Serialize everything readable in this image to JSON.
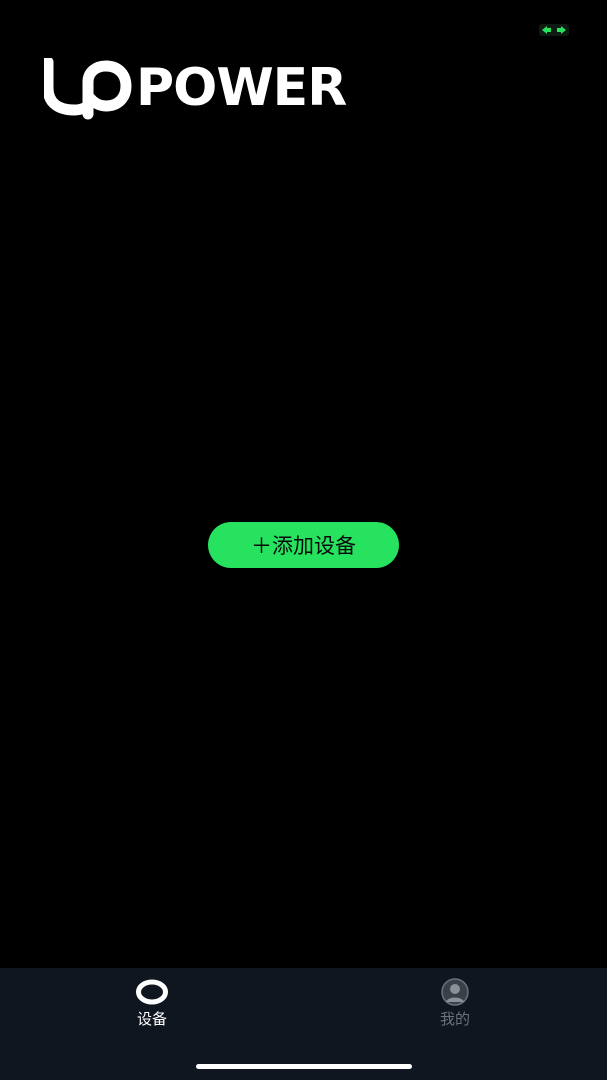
{
  "status": {
    "expand_icon": "expand-arrows-icon",
    "accent_color": "#27e25e"
  },
  "header": {
    "logo_text": "POWER",
    "logo_mark": "U"
  },
  "main": {
    "add_device_label": "＋添加设备",
    "button_color": "#27e25e"
  },
  "tabbar": {
    "background": "#0f1620",
    "tabs": [
      {
        "label": "设备",
        "icon": "ring-icon",
        "active": true
      },
      {
        "label": "我的",
        "icon": "user-avatar-icon",
        "active": false
      }
    ]
  }
}
